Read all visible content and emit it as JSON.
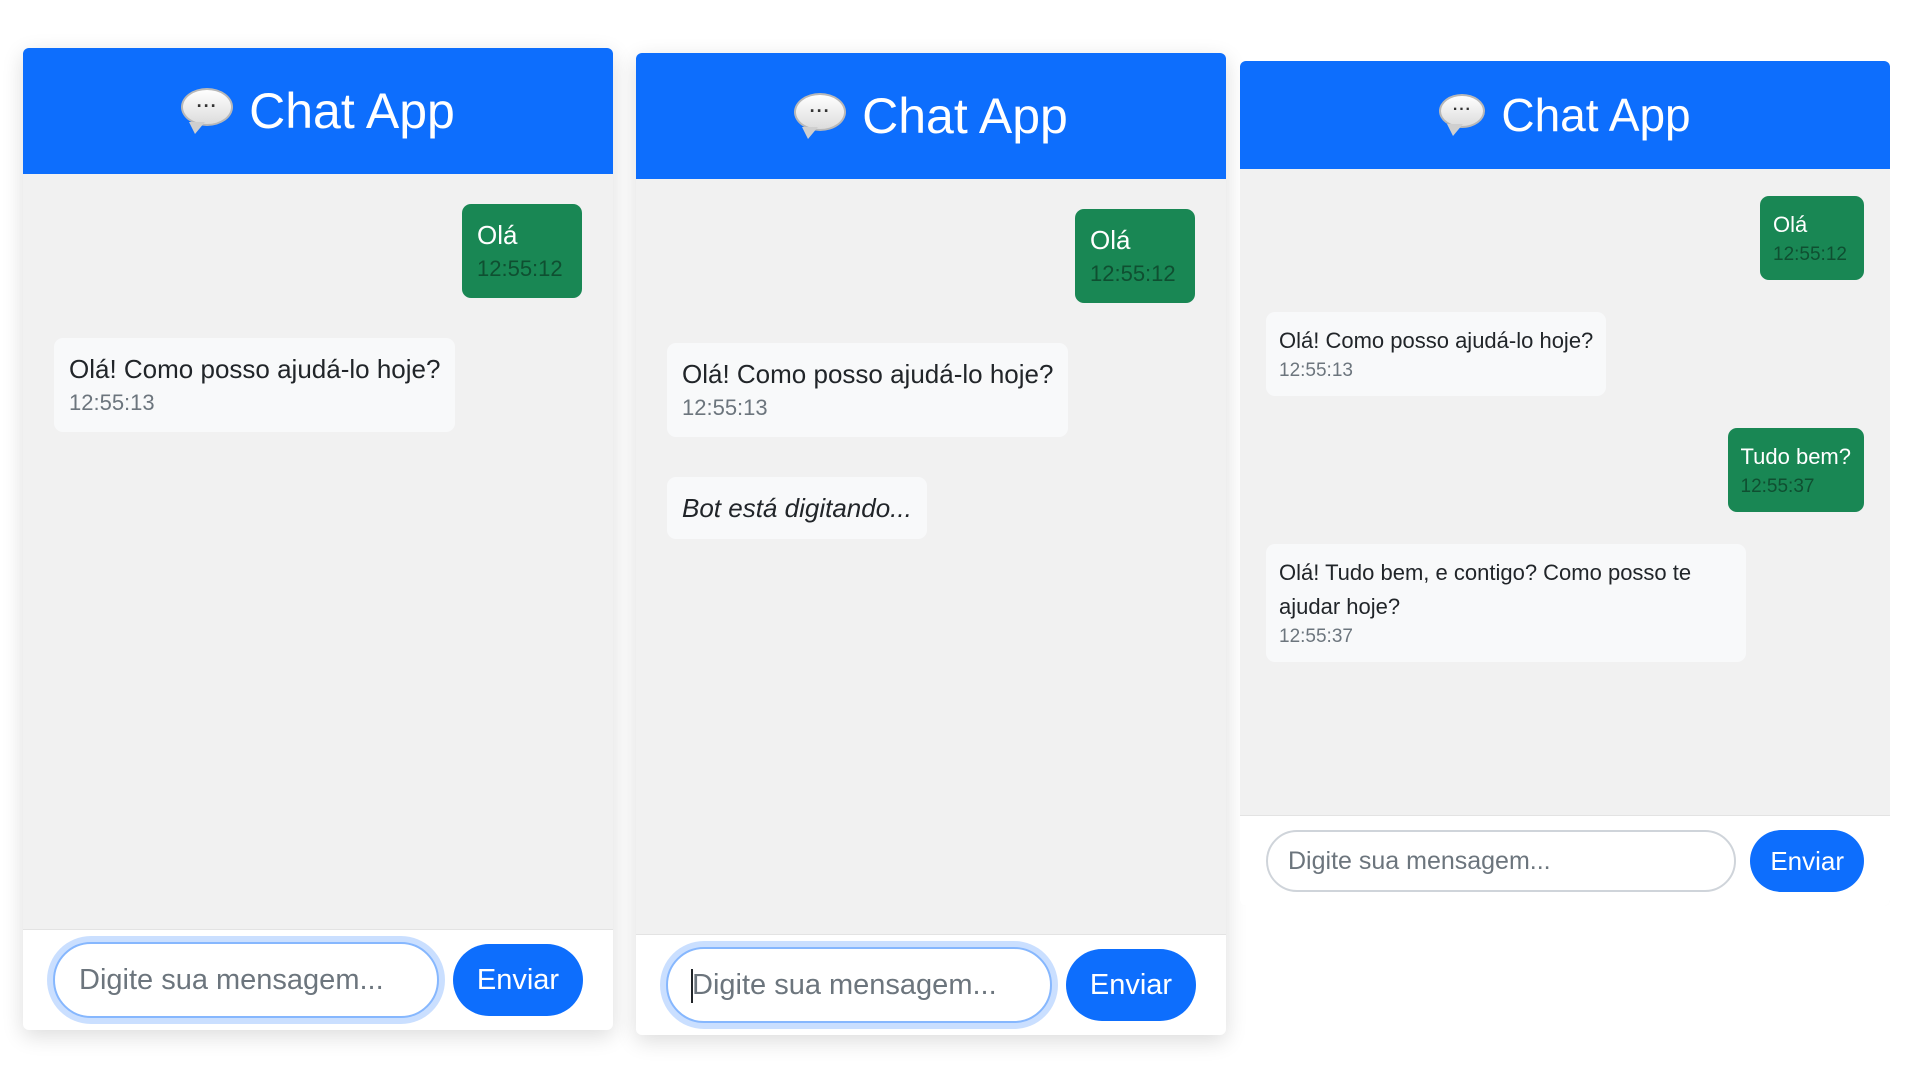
{
  "panels": [
    {
      "header": {
        "icon": "speech-bubble-icon",
        "title": "Chat App"
      },
      "messages": [
        {
          "sender": "user",
          "text": "Olá",
          "time": "12:55:12"
        },
        {
          "sender": "bot",
          "text": "Olá! Como posso ajudá-lo hoje?",
          "time": "12:55:13"
        }
      ],
      "input": {
        "value": "",
        "placeholder": "Digite sua mensagem...",
        "send_label": "Enviar"
      }
    },
    {
      "header": {
        "icon": "speech-bubble-icon",
        "title": "Chat App"
      },
      "messages": [
        {
          "sender": "user",
          "text": "Olá",
          "time": "12:55:12"
        },
        {
          "sender": "bot",
          "text": "Olá! Como posso ajudá-lo hoje?",
          "time": "12:55:13"
        }
      ],
      "typing_indicator": "Bot está digitando...",
      "input": {
        "value": "",
        "placeholder": "Digite sua mensagem...",
        "send_label": "Enviar"
      }
    },
    {
      "header": {
        "icon": "speech-bubble-icon",
        "title": "Chat App"
      },
      "messages": [
        {
          "sender": "user",
          "text": "Olá",
          "time": "12:55:12"
        },
        {
          "sender": "bot",
          "text": "Olá! Como posso ajudá-lo hoje?",
          "time": "12:55:13"
        },
        {
          "sender": "user",
          "text": "Tudo bem?",
          "time": "12:55:37"
        },
        {
          "sender": "bot",
          "text": "Olá! Tudo bem, e contigo? Como posso te ajudar hoje?",
          "time": "12:55:37"
        }
      ],
      "input": {
        "value": "",
        "placeholder": "Digite sua mensagem...",
        "send_label": "Enviar"
      }
    }
  ],
  "colors": {
    "header": "#0d6efd",
    "user_bubble": "#198754",
    "bot_bubble": "#f8f9fa",
    "chat_background": "#f1f1f1",
    "send_button": "#0d6efd"
  }
}
